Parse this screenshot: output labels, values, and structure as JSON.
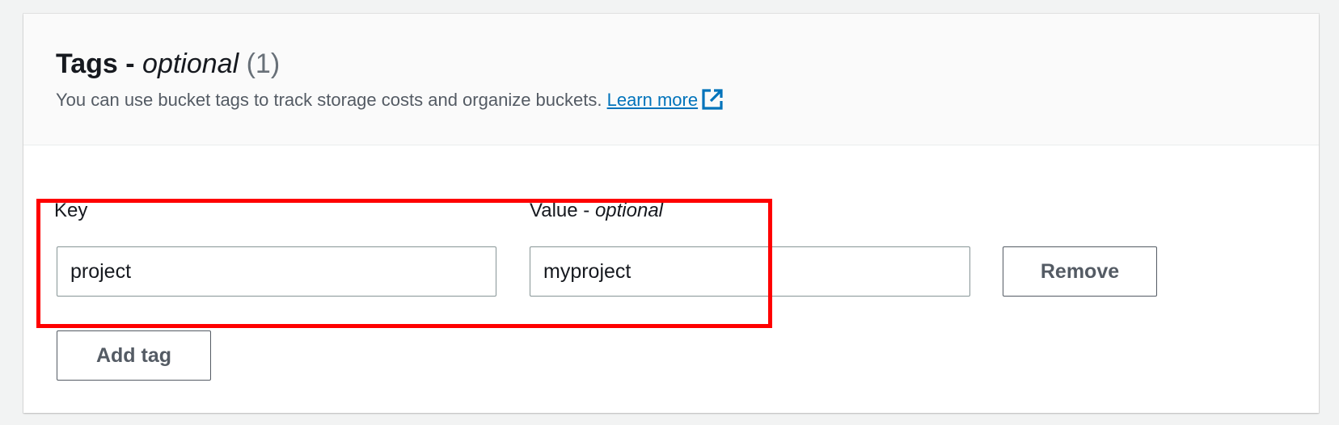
{
  "tags_panel": {
    "title": "Tags - ",
    "title_optional": "optional",
    "count": "(1)",
    "description": "You can use bucket tags to track storage costs and organize buckets. ",
    "learn_more": "Learn more",
    "learn_more_icon": "external-link-icon",
    "accent_color": "#0073bb"
  },
  "tag_row": {
    "key_label": "Key",
    "key_value": "project",
    "value_label": "Value - ",
    "value_label_optional": "optional",
    "value_value": "myproject",
    "remove_label": "Remove"
  },
  "add_tag_label": "Add tag",
  "highlight_color": "#ff0000"
}
